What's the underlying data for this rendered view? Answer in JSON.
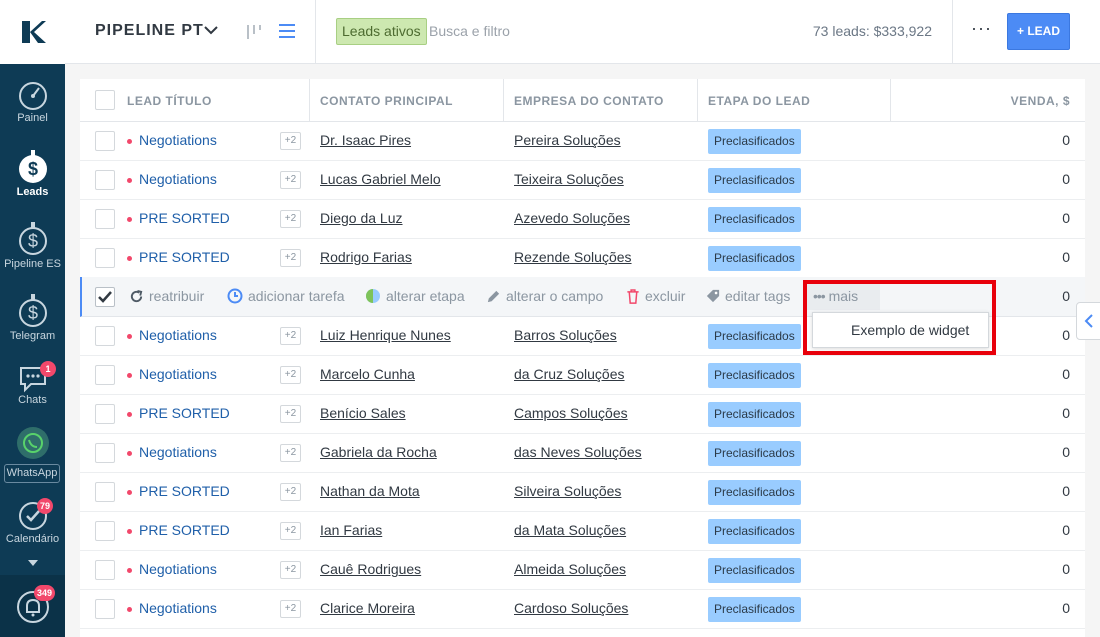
{
  "sidebar": {
    "items": [
      {
        "label": "Painel",
        "icon": "dashboard-icon"
      },
      {
        "label": "Leads",
        "icon": "leads-icon"
      },
      {
        "label": "Pipeline ES",
        "icon": "pipeline-icon"
      },
      {
        "label": "Telegram",
        "icon": "telegram-icon"
      },
      {
        "label": "Chats",
        "icon": "chats-icon",
        "badge": "1"
      },
      {
        "label": "WhatsApp",
        "icon": "whatsapp-icon"
      },
      {
        "label": "Calendário",
        "icon": "calendar-check-icon",
        "badge": "79"
      }
    ],
    "notifications_badge": "349"
  },
  "header": {
    "pipeline_name": "PIPELINE PT",
    "filter_chip": "Leads ativos",
    "search_placeholder": "Busca e filtro",
    "summary": "73 leads: $333,922",
    "more": "···",
    "add_button": "+ LEAD"
  },
  "table": {
    "columns": [
      "LEAD TÍTULO",
      "CONTATO PRINCIPAL",
      "EMPRESA DO CONTATO",
      "ETAPA DO LEAD",
      "VENDA, $"
    ],
    "rows": [
      {
        "name": "Negotiations",
        "tag": "+2",
        "contact": "Dr. Isaac Pires",
        "company": "Pereira Soluções",
        "stage": "Preclasificados",
        "sale": "0"
      },
      {
        "name": "Negotiations",
        "tag": "+2",
        "contact": "Lucas Gabriel Melo",
        "company": "Teixeira Soluções",
        "stage": "Preclasificados",
        "sale": "0"
      },
      {
        "name": "PRE SORTED",
        "tag": "+2",
        "contact": "Diego da Luz",
        "company": "Azevedo Soluções",
        "stage": "Preclasificados",
        "sale": "0"
      },
      {
        "name": "PRE SORTED",
        "tag": "+2",
        "contact": "Rodrigo Farias",
        "company": "Rezende Soluções",
        "stage": "Preclasificados",
        "sale": "0"
      },
      {
        "name": "Negotiations",
        "tag": "+2",
        "contact": "Luiz Henrique Nunes",
        "company": "Barros Soluções",
        "stage": "Preclasificados",
        "sale": "0"
      },
      {
        "name": "Negotiations",
        "tag": "+2",
        "contact": "Marcelo Cunha",
        "company": "da Cruz Soluções",
        "stage": "Preclasificados",
        "sale": "0"
      },
      {
        "name": "PRE SORTED",
        "tag": "+2",
        "contact": "Benício Sales",
        "company": "Campos Soluções",
        "stage": "Preclasificados",
        "sale": "0"
      },
      {
        "name": "Negotiations",
        "tag": "+2",
        "contact": "Gabriela da Rocha",
        "company": "das Neves Soluções",
        "stage": "Preclasificados",
        "sale": "0"
      },
      {
        "name": "PRE SORTED",
        "tag": "+2",
        "contact": "Nathan da Mota",
        "company": "Silveira Soluções",
        "stage": "Preclasificados",
        "sale": "0"
      },
      {
        "name": "PRE SORTED",
        "tag": "+2",
        "contact": "Ian Farias",
        "company": "da Mata Soluções",
        "stage": "Preclasificados",
        "sale": "0"
      },
      {
        "name": "Negotiations",
        "tag": "+2",
        "contact": "Cauê Rodrigues",
        "company": "Almeida Soluções",
        "stage": "Preclasificados",
        "sale": "0"
      },
      {
        "name": "Negotiations",
        "tag": "+2",
        "contact": "Clarice Moreira",
        "company": "Cardoso Soluções",
        "stage": "Preclasificados",
        "sale": "0"
      }
    ],
    "selected_row_sale": "0"
  },
  "actions": {
    "reassign": "reatribuir",
    "add_task": "adicionar tarefa",
    "change_stage": "alterar etapa",
    "change_field": "alterar o campo",
    "delete": "excluir",
    "edit_tags": "editar tags",
    "more": "mais"
  },
  "dropdown": {
    "item": "Exemplo de widget"
  },
  "colors": {
    "accent": "#4c8bf5",
    "sidebar": "#0e3b55",
    "stage": "#99ccff",
    "highlight": "#e8000b",
    "badge": "#f2486b"
  }
}
